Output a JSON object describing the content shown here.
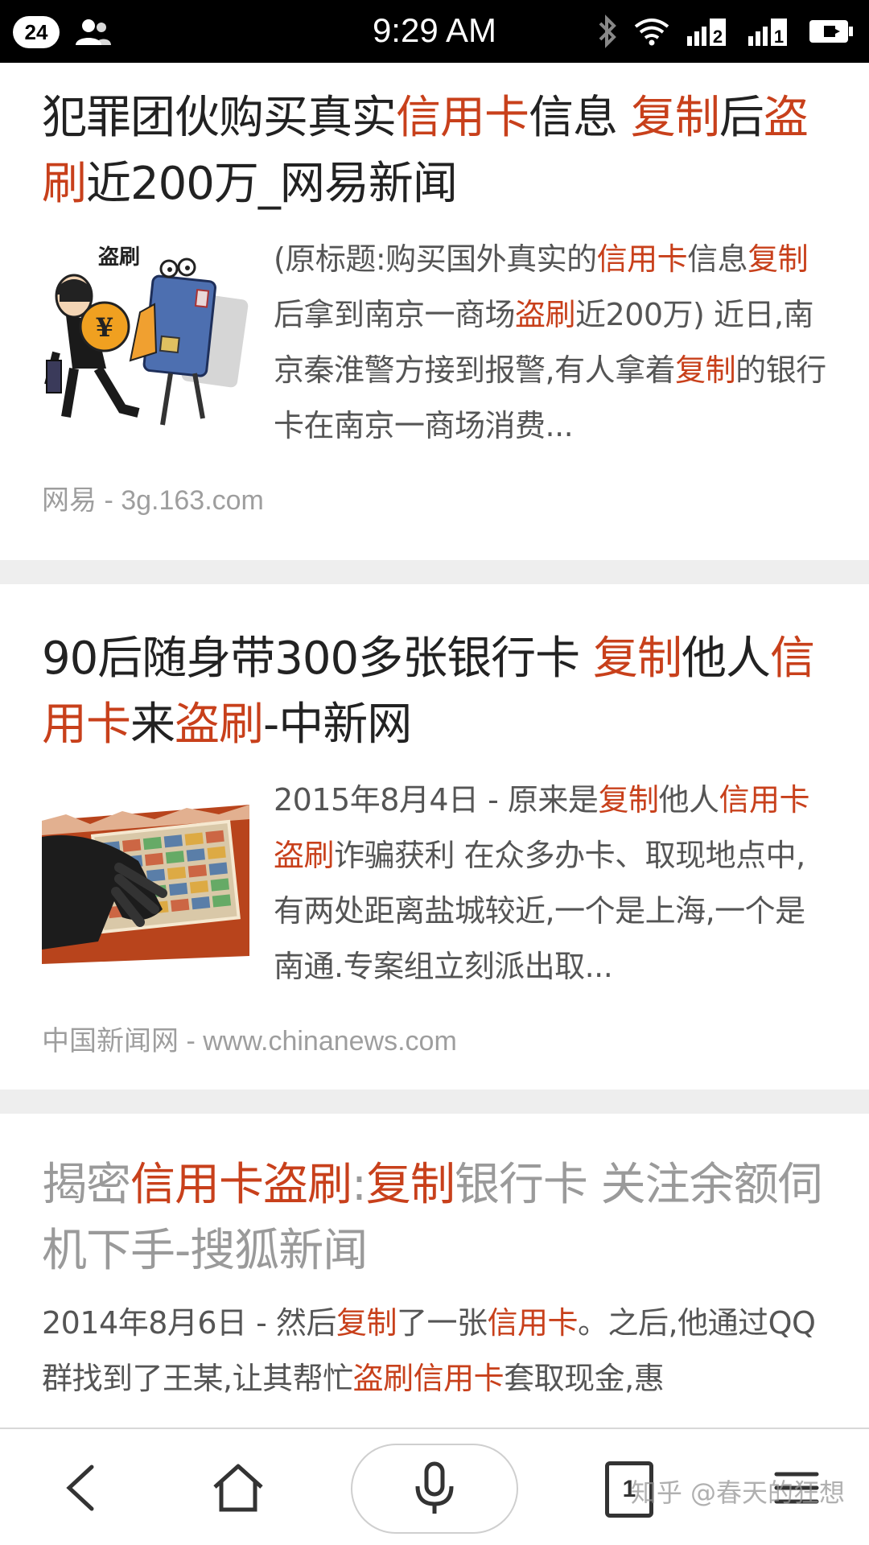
{
  "status_bar": {
    "notification_count": "24",
    "time": "9:29 AM",
    "sim1_label": "2",
    "sim2_label": "1"
  },
  "results": [
    {
      "title_segments": [
        {
          "t": "犯罪团伙购买真实",
          "hl": false
        },
        {
          "t": "信用卡",
          "hl": true
        },
        {
          "t": "信息 ",
          "hl": false
        },
        {
          "t": "复制",
          "hl": true
        },
        {
          "t": "后",
          "hl": false
        },
        {
          "t": "盗刷",
          "hl": true
        },
        {
          "t": "近200万_网易新闻",
          "hl": false
        }
      ],
      "image_text": "盗刷",
      "snippet_segments": [
        {
          "t": "(原标题:购买国外真实的",
          "hl": false
        },
        {
          "t": "信用卡",
          "hl": true
        },
        {
          "t": "信息",
          "hl": false
        },
        {
          "t": "复制",
          "hl": true
        },
        {
          "t": "后拿到南京一商场",
          "hl": false
        },
        {
          "t": "盗刷",
          "hl": true
        },
        {
          "t": "近200万) 近日,南京秦淮警方接到报警,有人拿着",
          "hl": false
        },
        {
          "t": "复制",
          "hl": true
        },
        {
          "t": "的银行卡在南京一商场消费...",
          "hl": false
        }
      ],
      "source": "网易 - 3g.163.com"
    },
    {
      "title_segments": [
        {
          "t": "90后随身带300多张银行卡 ",
          "hl": false
        },
        {
          "t": "复制",
          "hl": true
        },
        {
          "t": "他人",
          "hl": false
        },
        {
          "t": "信用卡",
          "hl": true
        },
        {
          "t": "来",
          "hl": false
        },
        {
          "t": "盗刷",
          "hl": true
        },
        {
          "t": "-中新网",
          "hl": false
        }
      ],
      "snippet_segments": [
        {
          "t": "2015年8月4日 - 原来是",
          "hl": false
        },
        {
          "t": "复制",
          "hl": true
        },
        {
          "t": "他人",
          "hl": false
        },
        {
          "t": "信用卡盗刷",
          "hl": true
        },
        {
          "t": "诈骗获利 在众多办卡、取现地点中,有两处距离盐城较近,一个是上海,一个是南通.专案组立刻派出取...",
          "hl": false
        }
      ],
      "source": "中国新闻网 - www.chinanews.com"
    },
    {
      "title_segments": [
        {
          "t": "揭密",
          "hl": false
        },
        {
          "t": "信用卡盗刷",
          "hl": true
        },
        {
          "t": ":",
          "hl": false
        },
        {
          "t": "复制",
          "hl": true
        },
        {
          "t": "银行卡 关注余额伺机下手-搜狐新闻",
          "hl": false
        }
      ],
      "snippet_segments": [
        {
          "t": "2014年8月6日 - 然后",
          "hl": false
        },
        {
          "t": "复制",
          "hl": true
        },
        {
          "t": "了一张",
          "hl": false
        },
        {
          "t": "信用卡",
          "hl": true
        },
        {
          "t": "。之后,他通过QQ群找到了王某,让其帮忙",
          "hl": false
        },
        {
          "t": "盗刷信用卡",
          "hl": true
        },
        {
          "t": "套取现金,惠",
          "hl": false
        }
      ]
    }
  ],
  "bottom_nav": {
    "tab_count": "1",
    "watermark": "知乎 @春天的狂想"
  },
  "colors": {
    "highlight": "#c8401b",
    "title": "#222222",
    "visited_title": "#9a9a9a",
    "snippet": "#555555",
    "source": "#9e9e9e",
    "separator": "#eeeeee"
  },
  "icons": [
    "person-icon",
    "bluetooth-icon",
    "wifi-icon",
    "signal-icon",
    "battery-icon",
    "back-arrow-icon",
    "home-icon",
    "mic-icon",
    "menu-icon"
  ]
}
